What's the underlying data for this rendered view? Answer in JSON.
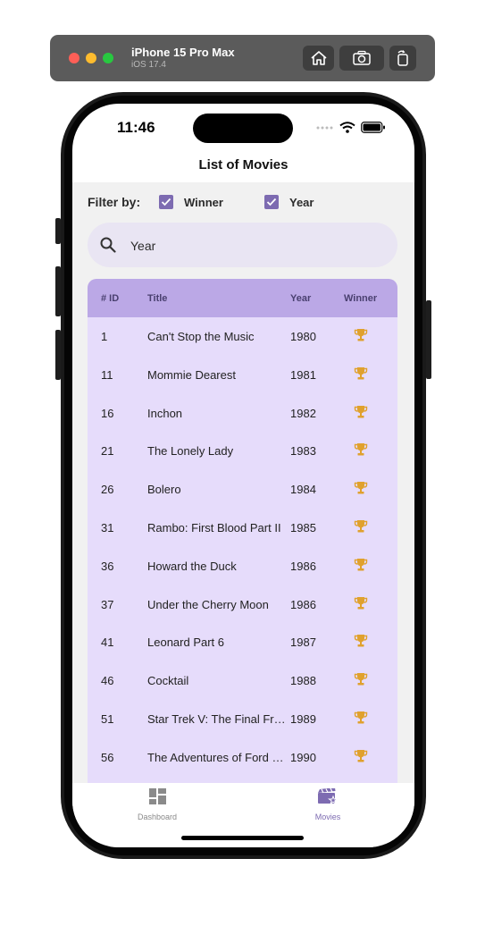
{
  "simulator": {
    "device_name": "iPhone 15 Pro Max",
    "os_version": "iOS 17.4"
  },
  "status_bar": {
    "time": "11:46"
  },
  "nav": {
    "title": "List of Movies"
  },
  "filter": {
    "label": "Filter by:",
    "options": [
      {
        "label": "Winner",
        "checked": true
      },
      {
        "label": "Year",
        "checked": true
      }
    ]
  },
  "search": {
    "placeholder": "Year"
  },
  "table": {
    "columns": [
      "# ID",
      "Title",
      "Year",
      "Winner"
    ],
    "rows": [
      {
        "id": "1",
        "title": "Can't Stop the Music",
        "year": "1980",
        "winner": true
      },
      {
        "id": "11",
        "title": "Mommie Dearest",
        "year": "1981",
        "winner": true
      },
      {
        "id": "16",
        "title": "Inchon",
        "year": "1982",
        "winner": true
      },
      {
        "id": "21",
        "title": "The Lonely Lady",
        "year": "1983",
        "winner": true
      },
      {
        "id": "26",
        "title": "Bolero",
        "year": "1984",
        "winner": true
      },
      {
        "id": "31",
        "title": "Rambo: First Blood Part II",
        "year": "1985",
        "winner": true
      },
      {
        "id": "36",
        "title": "Howard the Duck",
        "year": "1986",
        "winner": true
      },
      {
        "id": "37",
        "title": "Under the Cherry Moon",
        "year": "1986",
        "winner": true
      },
      {
        "id": "41",
        "title": "Leonard Part 6",
        "year": "1987",
        "winner": true
      },
      {
        "id": "46",
        "title": "Cocktail",
        "year": "1988",
        "winner": true
      },
      {
        "id": "51",
        "title": "Star Trek V: The Final Fro...",
        "year": "1989",
        "winner": true
      },
      {
        "id": "56",
        "title": "The Adventures of Ford F...",
        "year": "1990",
        "winner": true
      }
    ]
  },
  "tabbar": {
    "tabs": [
      {
        "label": "Dashboard",
        "icon": "dashboard-icon",
        "active": false
      },
      {
        "label": "Movies",
        "icon": "movies-icon",
        "active": true
      }
    ]
  },
  "colors": {
    "accent": "#7d6bb1",
    "table_header": "#bba8e6",
    "table_body": "#e6dcfb",
    "trophy": "#e0a12d",
    "tab_inactive": "#8a8a8a"
  }
}
